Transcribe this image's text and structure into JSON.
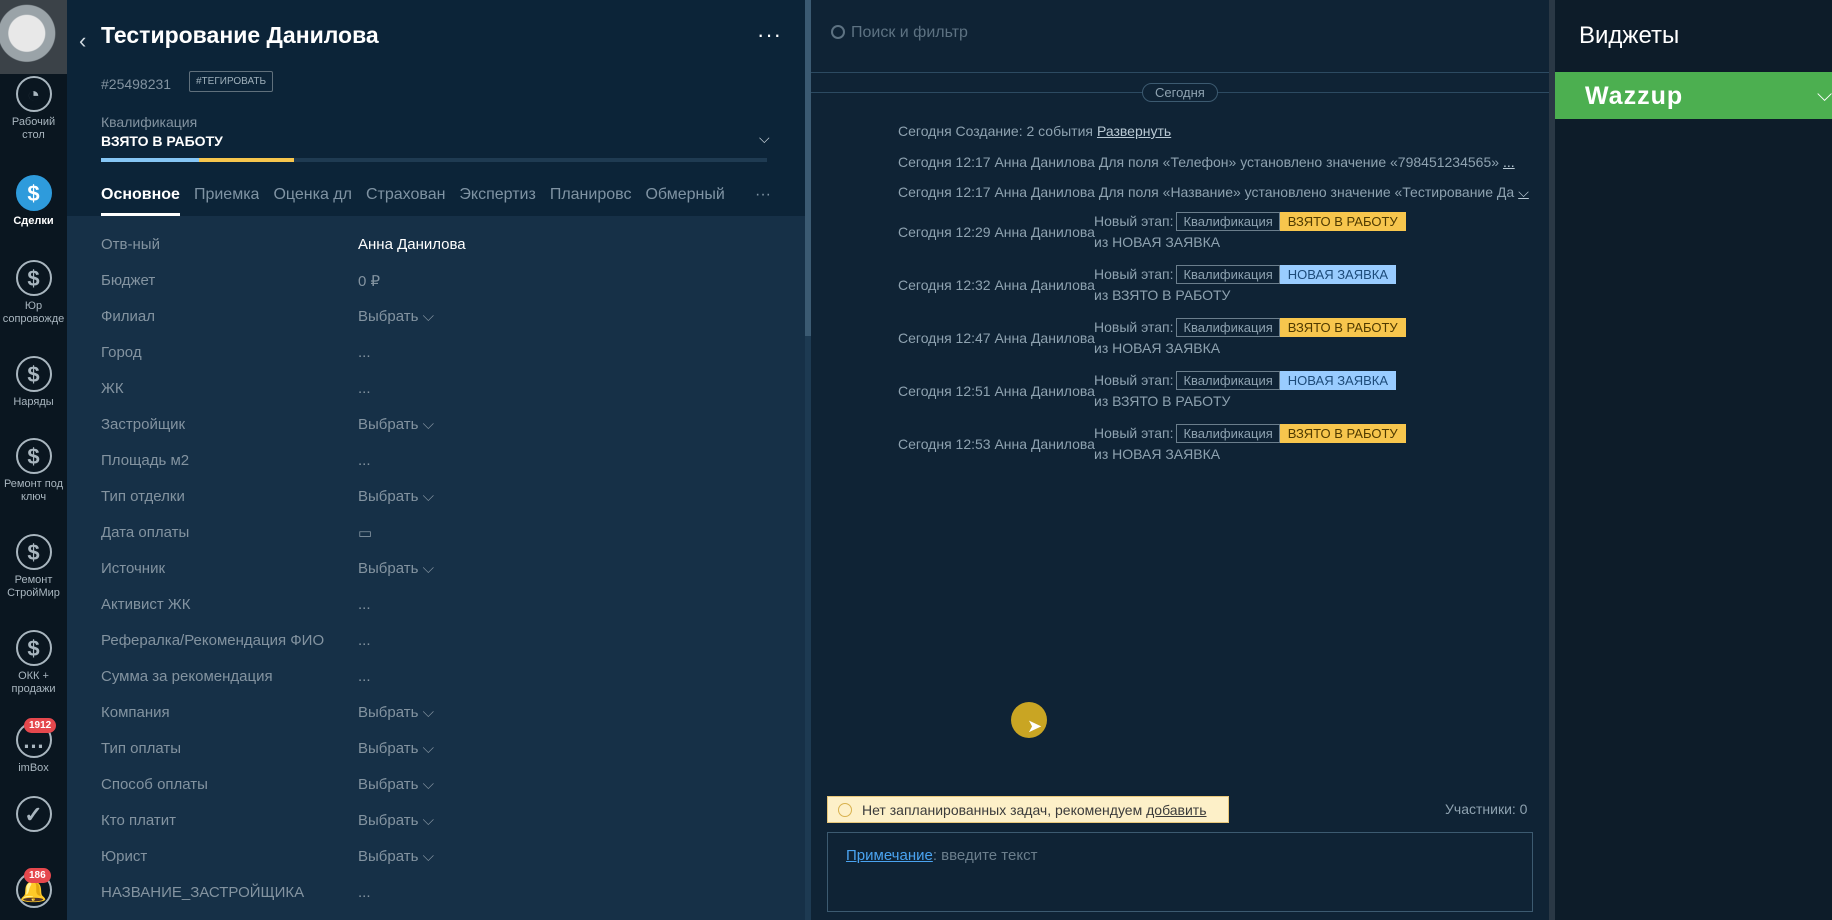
{
  "nav": {
    "items": [
      {
        "label": "Рабочий стол",
        "icon": "dashboard-icon"
      },
      {
        "label": "Сделки",
        "icon": "dollar-icon",
        "active": true
      },
      {
        "label": "Юр сопровожде",
        "icon": "dollar-icon"
      },
      {
        "label": "Наряды",
        "icon": "dollar-icon"
      },
      {
        "label": "Ремонт под ключ",
        "icon": "dollar-icon"
      },
      {
        "label": "Ремонт СтройМир",
        "icon": "dollar-icon"
      },
      {
        "label": "ОКК + продажи",
        "icon": "dollar-icon"
      },
      {
        "label": "imBox",
        "icon": "chat-icon",
        "badge": "1912"
      },
      {
        "label": "",
        "icon": "check-icon"
      },
      {
        "label": "",
        "icon": "bell-icon",
        "badge": "186"
      }
    ]
  },
  "card": {
    "title": "Тестирование Данилова",
    "id": "#25498231",
    "tag_button": "#ТЕГИРОВАТЬ",
    "stage_label": "Квалификация",
    "stage_value": "ВЗЯТО В РАБОТУ",
    "tabs": [
      "Основное",
      "Приемка",
      "Оценка дл",
      "Страхован",
      "Экспертиз",
      "Планировс",
      "Обмерный"
    ],
    "fields": [
      {
        "label": "Отв-ный",
        "value": "Анна Данилова",
        "strong": true
      },
      {
        "label": "Бюджет",
        "value": "0 ₽"
      },
      {
        "label": "Филиал",
        "value": "Выбрать ⌵"
      },
      {
        "label": "Город",
        "value": "..."
      },
      {
        "label": "ЖК",
        "value": "..."
      },
      {
        "label": "Застройщик",
        "value": "Выбрать ⌵"
      },
      {
        "label": "Площадь м2",
        "value": "..."
      },
      {
        "label": "Тип отделки",
        "value": "Выбрать ⌵"
      },
      {
        "label": "Дата оплаты",
        "value": "▭"
      },
      {
        "label": "Источник",
        "value": "Выбрать ⌵"
      },
      {
        "label": "Активист ЖК",
        "value": "..."
      },
      {
        "label": "Рефералка/Рекомендация ФИО",
        "value": "..."
      },
      {
        "label": "Сумма за рекомендация",
        "value": "..."
      },
      {
        "label": "Компания",
        "value": "Выбрать ⌵"
      },
      {
        "label": "Тип оплаты",
        "value": "Выбрать ⌵"
      },
      {
        "label": "Способ оплаты",
        "value": "Выбрать ⌵"
      },
      {
        "label": "Кто платит",
        "value": "Выбрать ⌵"
      },
      {
        "label": "Юрист",
        "value": "Выбрать ⌵"
      },
      {
        "label": "НАЗВАНИЕ_ЗАСТРОЙЩИКА",
        "value": "..."
      }
    ]
  },
  "feed": {
    "search_placeholder": "Поиск и фильтр",
    "day": "Сегодня",
    "events": [
      {
        "text": "Сегодня Создание: 2 события",
        "link": "Развернуть"
      },
      {
        "text": "Сегодня 12:17 Анна Данилова Для поля «Телефон» установлено значение «798451234565»",
        "link": "..."
      },
      {
        "text": "Сегодня 12:17 Анна Данилова Для поля «Название» установлено значение «Тестирование Да",
        "link": "⌵"
      }
    ],
    "stage_events": [
      {
        "when": "Сегодня 12:29 Анна Данилова",
        "new": "Новый этап:",
        "pipeline": "Квалификация",
        "stage": "ВЗЯТО В РАБОТУ",
        "color": "yellow",
        "from": "из НОВАЯ ЗАЯВКА"
      },
      {
        "when": "Сегодня 12:32 Анна Данилова",
        "new": "Новый этап:",
        "pipeline": "Квалификация",
        "stage": "НОВАЯ ЗАЯВКА",
        "color": "blue",
        "from": "из ВЗЯТО В РАБОТУ"
      },
      {
        "when": "Сегодня 12:47 Анна Данилова",
        "new": "Новый этап:",
        "pipeline": "Квалификация",
        "stage": "ВЗЯТО В РАБОТУ",
        "color": "yellow",
        "from": "из НОВАЯ ЗАЯВКА"
      },
      {
        "when": "Сегодня 12:51 Анна Данилова",
        "new": "Новый этап:",
        "pipeline": "Квалификация",
        "stage": "НОВАЯ ЗАЯВКА",
        "color": "blue",
        "from": "из ВЗЯТО В РАБОТУ"
      },
      {
        "when": "Сегодня 12:53 Анна Данилова",
        "new": "Новый этап:",
        "pipeline": "Квалификация",
        "stage": "ВЗЯТО В РАБОТУ",
        "color": "yellow",
        "from": "из НОВАЯ ЗАЯВКА"
      }
    ],
    "task_text": "Нет запланированных задач, рекомендуем",
    "task_link": "добавить",
    "participants": "Участники: 0",
    "note_label": "Примечание",
    "note_placeholder": ": введите текст"
  },
  "widgets": {
    "title": "Виджеты",
    "items": [
      {
        "name": "Wazzup",
        "color": "#4caf50"
      }
    ]
  }
}
